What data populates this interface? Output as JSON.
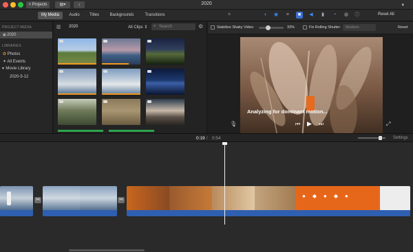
{
  "window": {
    "title": "2020",
    "projects_label": "< Projects",
    "reset_all_label": "Reset All"
  },
  "tabs": [
    {
      "label": "My Media",
      "active": true
    },
    {
      "label": "Audio",
      "active": false
    },
    {
      "label": "Titles",
      "active": false
    },
    {
      "label": "Backgrounds",
      "active": false
    },
    {
      "label": "Transitions",
      "active": false
    }
  ],
  "sidebar": {
    "project_media_heading": "PROJECT MEDIA",
    "project_item": "2020",
    "libraries_heading": "LIBRARIES",
    "items": [
      {
        "label": "Photos",
        "icon": "photos-icon"
      },
      {
        "label": "All Events",
        "icon": "star-icon"
      },
      {
        "label": "Movie Library",
        "icon": "disclosure-icon"
      },
      {
        "label": "2020-5-12",
        "icon": ""
      }
    ]
  },
  "browser": {
    "event_title": "2020",
    "filter_label": "All Clips",
    "search_placeholder": "Search"
  },
  "viewer": {
    "stabilize_label": "Stabilize Shaky Video",
    "stabilize_value": "33%",
    "rolling_shutter_label": "Fix Rolling Shutter:",
    "rolling_shutter_value": "Medium",
    "reset_label": "Reset",
    "analyzing_text": "Analyzing for dominant motion..."
  },
  "timeline": {
    "current_time": "0:19",
    "separator": "/",
    "total_time": "0:54",
    "settings_label": "Settings"
  },
  "colors": {
    "accent": "#3b6fd4",
    "audio": "#2f5fb0",
    "orange": "#e7671a",
    "progress": "#f39a1f",
    "green": "#2ea44f"
  }
}
